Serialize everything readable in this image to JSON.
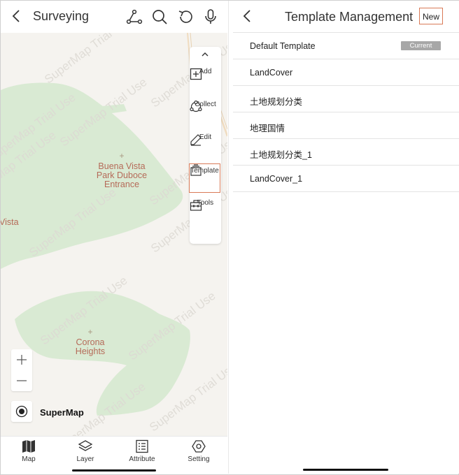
{
  "left": {
    "title": "Surveying",
    "watermark": "SuperMap Trial Use",
    "places": {
      "buena_vista_entrance": "Buena Vista Park Duboce Entrance",
      "corona_heights": "Corona Heights",
      "vista": "Vista"
    },
    "toolbox": {
      "add": "Add",
      "collect": "Collect",
      "edit": "Edit",
      "template": "Template",
      "tools": "Tools"
    },
    "brand": "SuperMap",
    "nav": {
      "map": "Map",
      "layer": "Layer",
      "attribute": "Attribute",
      "setting": "Setting"
    }
  },
  "right": {
    "title": "Template Management",
    "new_label": "New",
    "current_badge": "Current",
    "templates": [
      "Default Template",
      "LandCover",
      "土地规划分类",
      "地理国情",
      "土地规划分类_1",
      "LandCover_1"
    ]
  },
  "colors": {
    "accent_outline": "#d97a57",
    "park_green": "#d9ead3",
    "map_background": "#f5f3ef",
    "place_label": "#b56a58"
  }
}
